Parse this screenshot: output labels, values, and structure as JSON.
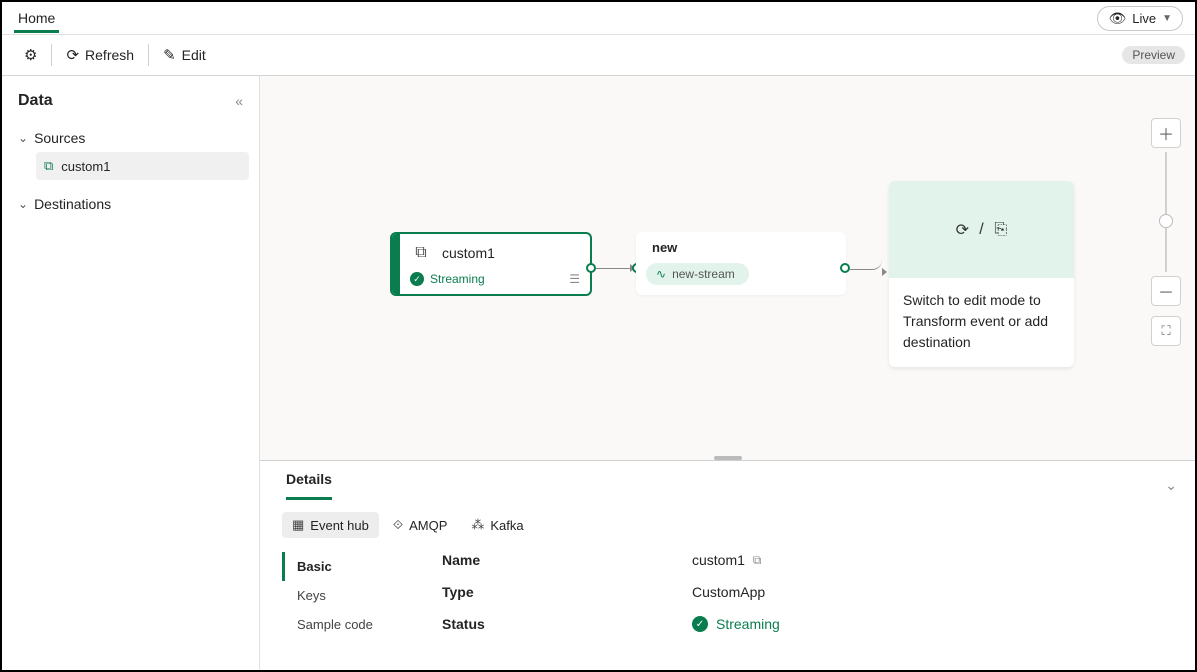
{
  "tabs": {
    "home": "Home"
  },
  "live": {
    "label": "Live"
  },
  "toolbar": {
    "refresh": "Refresh",
    "edit": "Edit",
    "preview": "Preview"
  },
  "sidebar": {
    "title": "Data",
    "sources_label": "Sources",
    "destinations_label": "Destinations",
    "items": [
      {
        "label": "custom1"
      }
    ]
  },
  "canvas": {
    "source": {
      "title": "custom1",
      "status": "Streaming"
    },
    "stream": {
      "title": "new",
      "chip": "new-stream"
    },
    "dest": {
      "text": "Switch to edit mode to Transform event or add destination",
      "separator": "/"
    }
  },
  "details": {
    "title": "Details",
    "protocols": [
      {
        "key": "eventhub",
        "label": "Event hub"
      },
      {
        "key": "amqp",
        "label": "AMQP"
      },
      {
        "key": "kafka",
        "label": "Kafka"
      }
    ],
    "subnav": [
      {
        "key": "basic",
        "label": "Basic"
      },
      {
        "key": "keys",
        "label": "Keys"
      },
      {
        "key": "sample",
        "label": "Sample code"
      }
    ],
    "props": {
      "name_label": "Name",
      "name_value": "custom1",
      "type_label": "Type",
      "type_value": "CustomApp",
      "status_label": "Status",
      "status_value": "Streaming"
    }
  }
}
